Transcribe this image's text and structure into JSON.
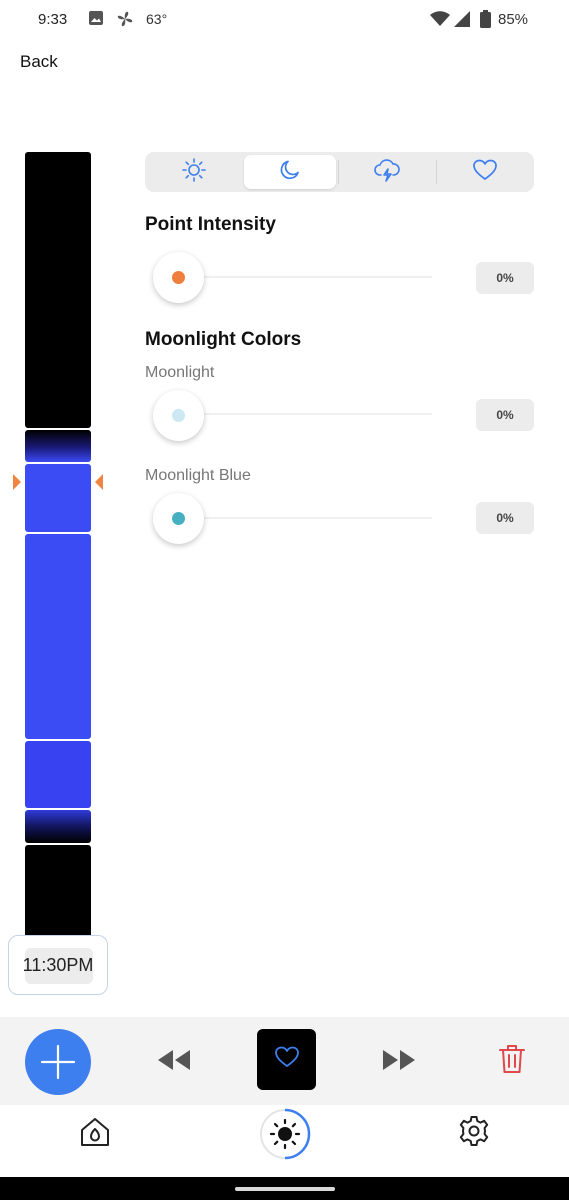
{
  "status_bar": {
    "time": "9:33",
    "temperature": "63°",
    "battery": "85%",
    "icons": [
      "image-icon",
      "fan-icon",
      "wifi-icon",
      "signal-icon",
      "battery-icon"
    ]
  },
  "nav": {
    "back_label": "Back"
  },
  "timeline": {
    "current_time": "11:30PM",
    "marker_color": "#ef8542",
    "colors": {
      "dark": "#000000",
      "blue": "#3c4cf4",
      "inactive": "#c8c8c8"
    }
  },
  "mode_tabs": [
    {
      "icon": "sun-icon",
      "active": false
    },
    {
      "icon": "moon-icon",
      "active": true
    },
    {
      "icon": "storm-icon",
      "active": false
    },
    {
      "icon": "heart-icon",
      "active": false
    }
  ],
  "point_intensity": {
    "title": "Point Intensity",
    "value": "0%",
    "knob_color": "#ee7f3d"
  },
  "moonlight": {
    "title": "Moonlight Colors",
    "sliders": [
      {
        "label": "Moonlight",
        "value": "0%",
        "knob_color": "#cbe8f3"
      },
      {
        "label": "Moonlight Blue",
        "value": "0%",
        "knob_color": "#47b0c0"
      }
    ]
  },
  "transport": {
    "accent": "#3e7ff0",
    "delete_color": "#e0484c",
    "icons": [
      "plus-icon",
      "rewind-icon",
      "heart-icon",
      "fast-forward-icon",
      "trash-icon"
    ]
  },
  "bottom_nav": {
    "items": [
      "home-icon",
      "sun-icon",
      "gear-icon"
    ],
    "active": "sun-icon"
  }
}
